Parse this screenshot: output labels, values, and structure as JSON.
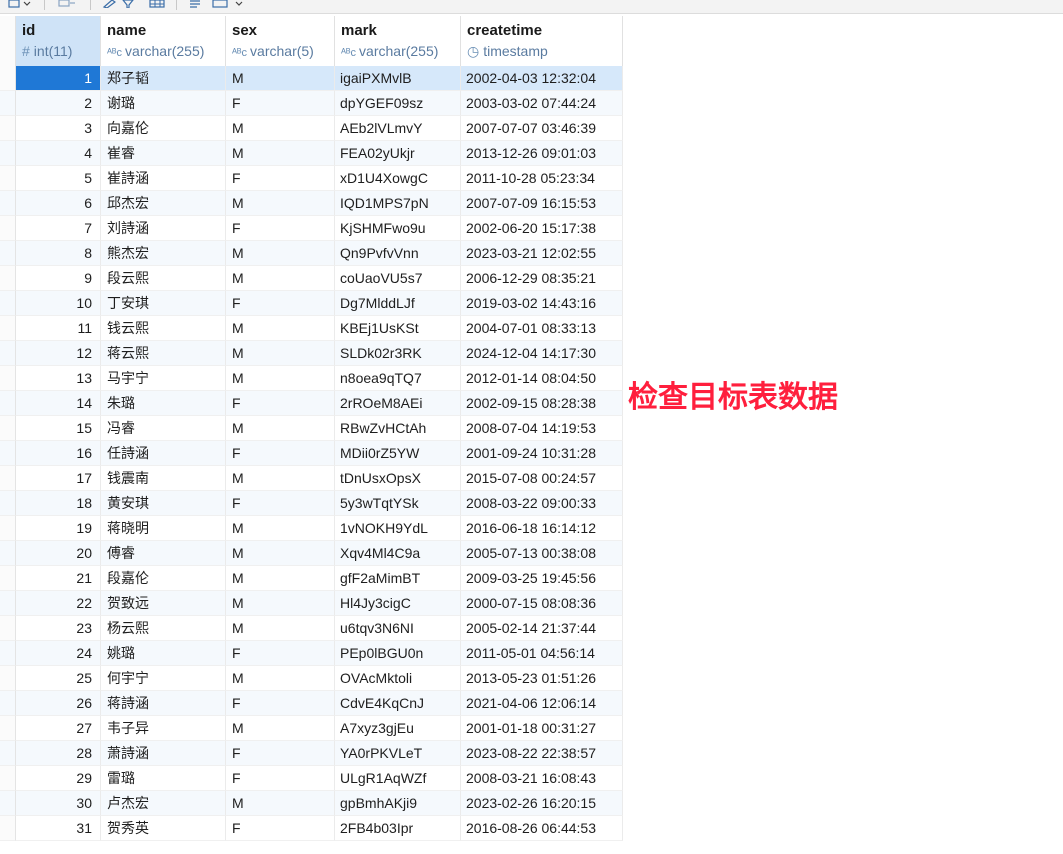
{
  "columns": [
    {
      "name": "id",
      "type": "int(11)",
      "type_icon": "hash-icon"
    },
    {
      "name": "name",
      "type": "varchar(255)",
      "type_icon": "text-type-icon"
    },
    {
      "name": "sex",
      "type": "varchar(5)",
      "type_icon": "text-type-icon"
    },
    {
      "name": "mark",
      "type": "varchar(255)",
      "type_icon": "text-type-icon"
    },
    {
      "name": "createtime",
      "type": "timestamp",
      "type_icon": "clock-icon"
    }
  ],
  "rows": [
    {
      "id": "1",
      "name": "郑子韬",
      "sex": "M",
      "mark": "igaiPXMvlB",
      "createtime": "2002-04-03 12:32:04"
    },
    {
      "id": "2",
      "name": "谢璐",
      "sex": "F",
      "mark": "dpYGEF09sz",
      "createtime": "2003-03-02 07:44:24"
    },
    {
      "id": "3",
      "name": "向嘉伦",
      "sex": "M",
      "mark": "AEb2lVLmvY",
      "createtime": "2007-07-07 03:46:39"
    },
    {
      "id": "4",
      "name": "崔睿",
      "sex": "M",
      "mark": "FEA02yUkjr",
      "createtime": "2013-12-26 09:01:03"
    },
    {
      "id": "5",
      "name": "崔詩涵",
      "sex": "F",
      "mark": "xD1U4XowgC",
      "createtime": "2011-10-28 05:23:34"
    },
    {
      "id": "6",
      "name": "邱杰宏",
      "sex": "M",
      "mark": "IQD1MPS7pN",
      "createtime": "2007-07-09 16:15:53"
    },
    {
      "id": "7",
      "name": "刘詩涵",
      "sex": "F",
      "mark": "KjSHMFwo9u",
      "createtime": "2002-06-20 15:17:38"
    },
    {
      "id": "8",
      "name": "熊杰宏",
      "sex": "M",
      "mark": "Qn9PvfvVnn",
      "createtime": "2023-03-21 12:02:55"
    },
    {
      "id": "9",
      "name": "段云熙",
      "sex": "M",
      "mark": "coUaoVU5s7",
      "createtime": "2006-12-29 08:35:21"
    },
    {
      "id": "10",
      "name": "丁安琪",
      "sex": "F",
      "mark": "Dg7MlddLJf",
      "createtime": "2019-03-02 14:43:16"
    },
    {
      "id": "11",
      "name": "钱云熙",
      "sex": "M",
      "mark": "KBEj1UsKSt",
      "createtime": "2004-07-01 08:33:13"
    },
    {
      "id": "12",
      "name": "蒋云熙",
      "sex": "M",
      "mark": "SLDk02r3RK",
      "createtime": "2024-12-04 14:17:30"
    },
    {
      "id": "13",
      "name": "马宇宁",
      "sex": "M",
      "mark": "n8oea9qTQ7",
      "createtime": "2012-01-14 08:04:50"
    },
    {
      "id": "14",
      "name": "朱璐",
      "sex": "F",
      "mark": "2rROeM8AEi",
      "createtime": "2002-09-15 08:28:38"
    },
    {
      "id": "15",
      "name": "冯睿",
      "sex": "M",
      "mark": "RBwZvHCtAh",
      "createtime": "2008-07-04 14:19:53"
    },
    {
      "id": "16",
      "name": "任詩涵",
      "sex": "F",
      "mark": "MDii0rZ5YW",
      "createtime": "2001-09-24 10:31:28"
    },
    {
      "id": "17",
      "name": "钱震南",
      "sex": "M",
      "mark": "tDnUsxOpsX",
      "createtime": "2015-07-08 00:24:57"
    },
    {
      "id": "18",
      "name": "黄安琪",
      "sex": "F",
      "mark": "5y3wTqtYSk",
      "createtime": "2008-03-22 09:00:33"
    },
    {
      "id": "19",
      "name": "蒋晓明",
      "sex": "M",
      "mark": "1vNOKH9YdL",
      "createtime": "2016-06-18 16:14:12"
    },
    {
      "id": "20",
      "name": "傅睿",
      "sex": "M",
      "mark": "Xqv4Ml4C9a",
      "createtime": "2005-07-13 00:38:08"
    },
    {
      "id": "21",
      "name": "段嘉伦",
      "sex": "M",
      "mark": "gfF2aMimBT",
      "createtime": "2009-03-25 19:45:56"
    },
    {
      "id": "22",
      "name": "贺致远",
      "sex": "M",
      "mark": "Hl4Jy3cigC",
      "createtime": "2000-07-15 08:08:36"
    },
    {
      "id": "23",
      "name": "杨云熙",
      "sex": "M",
      "mark": "u6tqv3N6NI",
      "createtime": "2005-02-14 21:37:44"
    },
    {
      "id": "24",
      "name": "姚璐",
      "sex": "F",
      "mark": "PEp0lBGU0n",
      "createtime": "2011-05-01 04:56:14"
    },
    {
      "id": "25",
      "name": "何宇宁",
      "sex": "M",
      "mark": "OVAcMktoli",
      "createtime": "2013-05-23 01:51:26"
    },
    {
      "id": "26",
      "name": "蒋詩涵",
      "sex": "F",
      "mark": "CdvE4KqCnJ",
      "createtime": "2021-04-06 12:06:14"
    },
    {
      "id": "27",
      "name": "韦子异",
      "sex": "M",
      "mark": "A7xyz3gjEu",
      "createtime": "2001-01-18 00:31:27"
    },
    {
      "id": "28",
      "name": "萧詩涵",
      "sex": "F",
      "mark": "YA0rPKVLeT",
      "createtime": "2023-08-22 22:38:57"
    },
    {
      "id": "29",
      "name": "雷璐",
      "sex": "F",
      "mark": "ULgR1AqWZf",
      "createtime": "2008-03-21 16:08:43"
    },
    {
      "id": "30",
      "name": "卢杰宏",
      "sex": "M",
      "mark": "gpBmhAKji9",
      "createtime": "2023-02-26 16:20:15"
    },
    {
      "id": "31",
      "name": "贺秀英",
      "sex": "F",
      "mark": "2FB4b03Ipr",
      "createtime": "2016-08-26 06:44:53"
    }
  ],
  "annotation": "检查目标表数据",
  "colors": {
    "selected": "#1f78d6",
    "annotation": "#ff1f3d",
    "type_text": "#5a7ba0"
  }
}
